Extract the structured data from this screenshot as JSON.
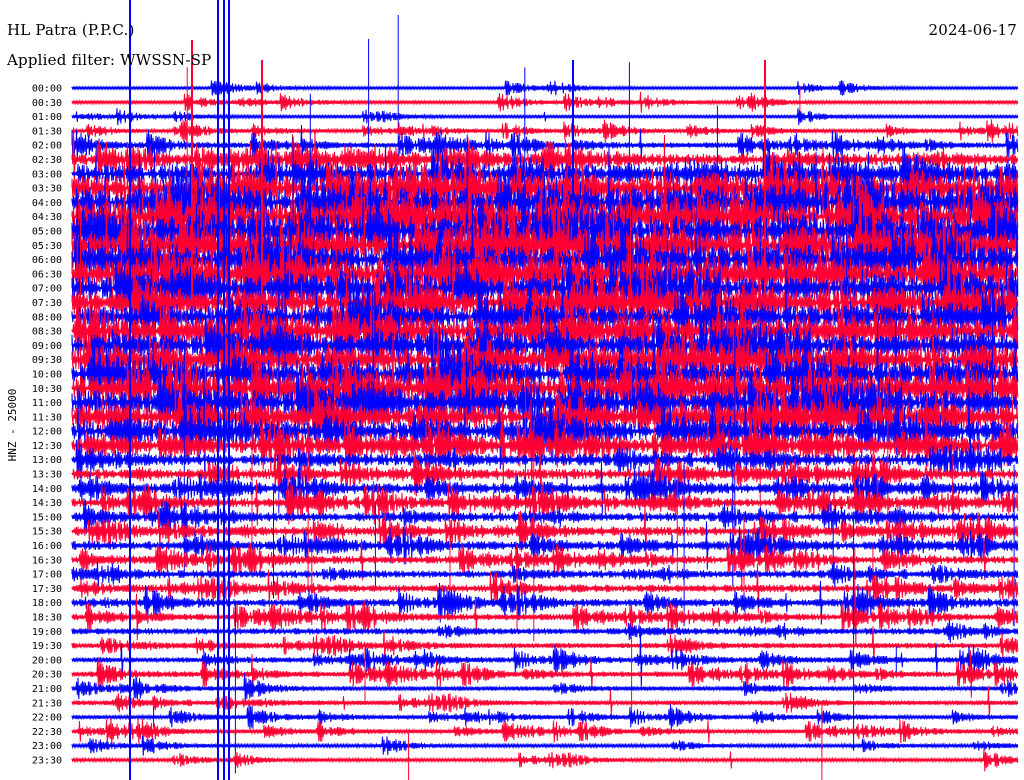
{
  "header": {
    "station": "HL Patra (P.P.C.)",
    "filter": "Applied filter: WWSSN-SP",
    "date": "2024-06-17"
  },
  "chart_data": {
    "type": "line",
    "title": "HL Patra (P.P.C.)",
    "subtitle": "Applied filter: WWSSN-SP",
    "date": "2024-06-17",
    "ylabel": "HNZ - 25000",
    "xlabel": "",
    "y_tick_labels": [
      "00:00",
      "00:30",
      "01:00",
      "01:30",
      "02:00",
      "02:30",
      "03:00",
      "03:30",
      "04:00",
      "04:30",
      "05:00",
      "05:30",
      "06:00",
      "06:30",
      "07:00",
      "07:30",
      "08:00",
      "08:30",
      "09:00",
      "09:30",
      "10:00",
      "10:30",
      "11:00",
      "11:30",
      "12:00",
      "12:30",
      "13:00",
      "13:30",
      "14:00",
      "14:30",
      "15:00",
      "15:30",
      "16:00",
      "16:30",
      "17:00",
      "17:30",
      "18:00",
      "18:30",
      "19:00",
      "19:30",
      "20:00",
      "20:30",
      "21:00",
      "21:30",
      "22:00",
      "22:30",
      "23:00",
      "23:30"
    ],
    "trace_minutes": 30,
    "series_colors": {
      "hour": "#0000ff",
      "half_hour": "#ff0033"
    },
    "relative_activity": [
      0.1,
      0.15,
      0.1,
      0.2,
      0.35,
      0.6,
      0.8,
      0.9,
      1,
      1,
      1,
      1,
      0.95,
      0.95,
      0.9,
      0.9,
      0.85,
      0.85,
      0.85,
      0.85,
      0.9,
      0.9,
      0.9,
      0.85,
      0.8,
      0.7,
      0.6,
      0.55,
      0.55,
      0.5,
      0.5,
      0.5,
      0.5,
      0.45,
      0.45,
      0.45,
      0.45,
      0.4,
      0.4,
      0.35,
      0.35,
      0.35,
      0.3,
      0.3,
      0.25,
      0.25,
      0.2,
      0.2
    ]
  }
}
